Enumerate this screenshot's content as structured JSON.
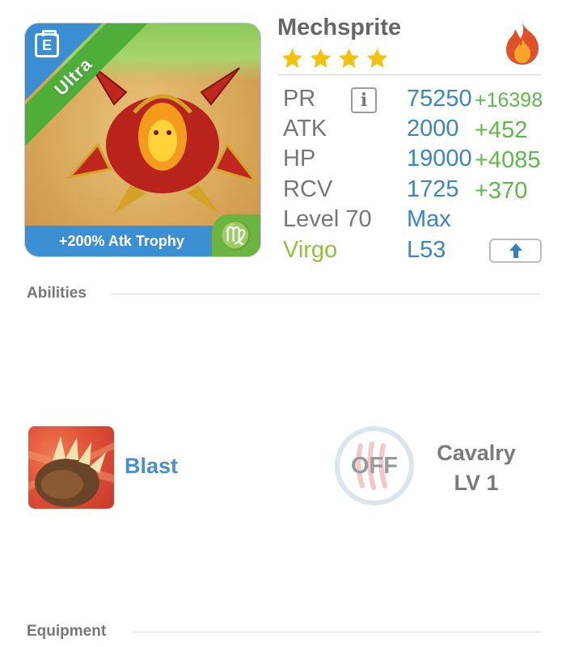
{
  "monster": {
    "name": "Mechsprite",
    "rarity": "Ultra",
    "stars": 4,
    "trophy": "+200% Atk Trophy",
    "element_icon": "flame-icon",
    "sign_glyph": "♍"
  },
  "stats": {
    "pr": {
      "label": "PR",
      "value": "75250",
      "bonus": "+16398"
    },
    "atk": {
      "label": "ATK",
      "value": "2000",
      "bonus": "+452"
    },
    "hp": {
      "label": "HP",
      "value": "19000",
      "bonus": "+4085"
    },
    "rcv": {
      "label": "RCV",
      "value": "1725",
      "bonus": "+370"
    },
    "level": {
      "label": "Level 70",
      "value": "Max"
    },
    "sign": {
      "label": "Virgo",
      "value": "L53"
    }
  },
  "sections": {
    "abilities": "Abilities",
    "equipment": "Equipment"
  },
  "ability": {
    "name": "Blast",
    "icon": "claw-fist-icon"
  },
  "cavalry": {
    "state": "OFF",
    "line1": "Cavalry",
    "line2": "LV 1"
  },
  "colors": {
    "accent_blue": "#3a86c4",
    "bonus_green": "#5fb84c",
    "virgo_green": "#8fc23a",
    "rarity_green": "#4fae3a"
  }
}
